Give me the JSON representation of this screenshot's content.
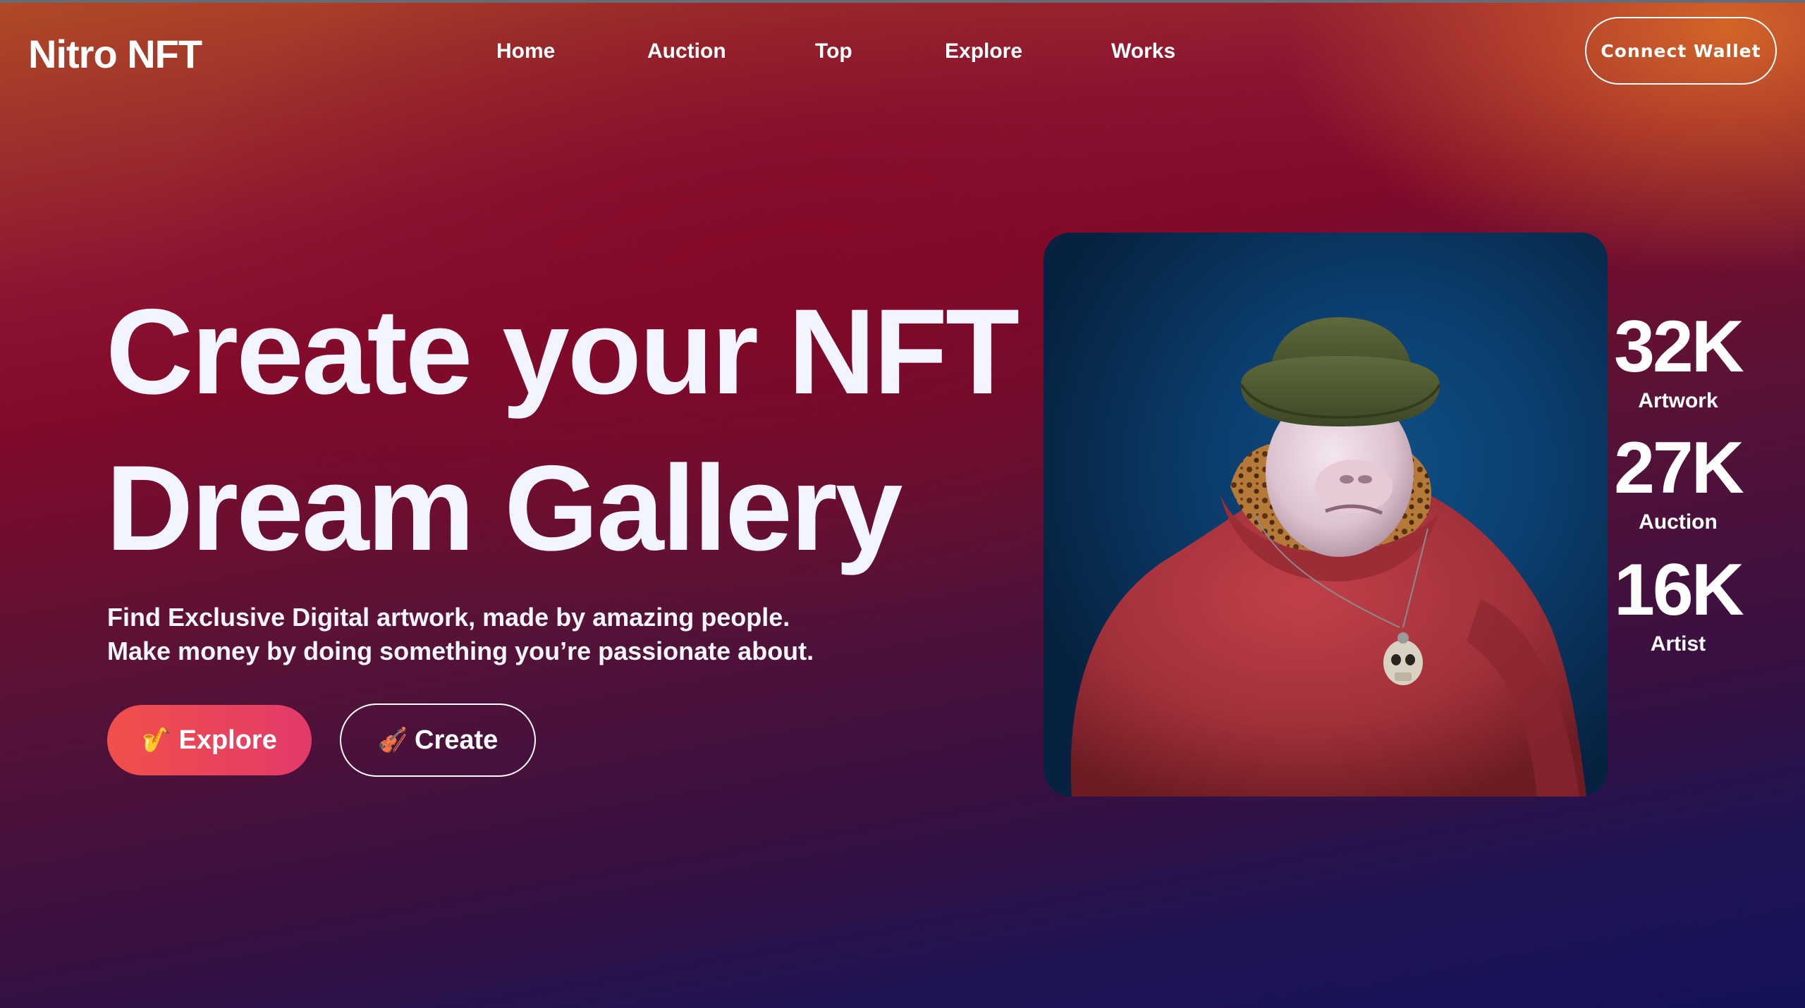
{
  "brand": {
    "name": "Nitro NFT"
  },
  "nav": {
    "links": [
      {
        "label": "Home"
      },
      {
        "label": "Auction"
      },
      {
        "label": "Top"
      },
      {
        "label": "Explore"
      },
      {
        "label": "Works"
      }
    ],
    "connect_label": "Connect Wallet"
  },
  "hero": {
    "title_line1": "Create your NFT",
    "title_line2": "Dream Gallery",
    "subtitle_line1": "Find Exclusive Digital artwork, made by amazing people.",
    "subtitle_line2": "Make money by doing something you’re passionate about.",
    "explore_label": "Explore",
    "explore_icon": "🎷",
    "create_label": "Create",
    "create_icon": "🎻"
  },
  "stats": [
    {
      "value": "32K",
      "label": "Artwork"
    },
    {
      "value": "27K",
      "label": "Auction"
    },
    {
      "value": "16K",
      "label": "Artist"
    }
  ],
  "colors": {
    "accent_start": "#f1504a",
    "accent_end": "#e23a6a",
    "text": "#f4f6ff"
  }
}
